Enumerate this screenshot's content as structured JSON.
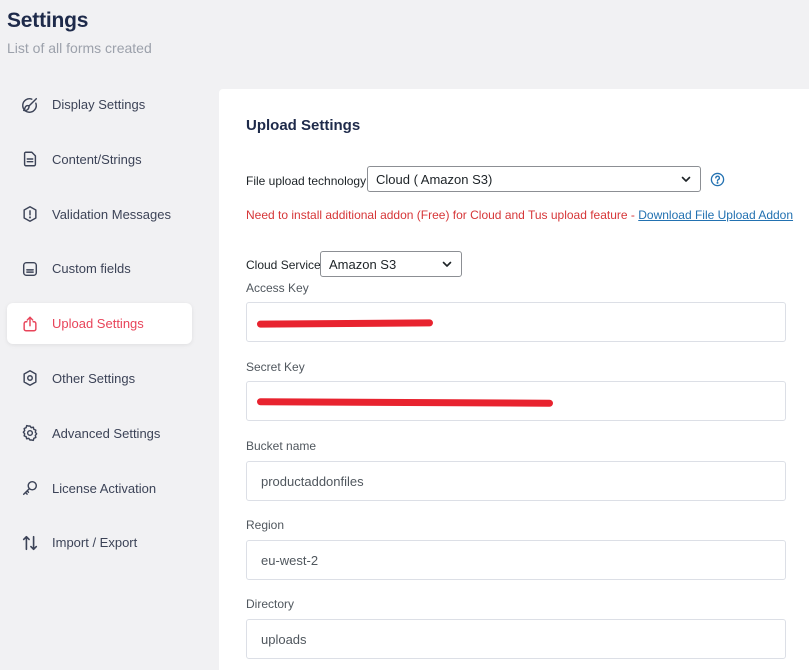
{
  "header": {
    "title": "Settings",
    "subtitle": "List of all forms created"
  },
  "sidebar": {
    "items": [
      {
        "label": "Display Settings",
        "icon": "brush-icon"
      },
      {
        "label": "Content/Strings",
        "icon": "document-icon"
      },
      {
        "label": "Validation Messages",
        "icon": "alert-icon"
      },
      {
        "label": "Custom fields",
        "icon": "card-icon"
      },
      {
        "label": "Upload Settings",
        "icon": "upload-icon",
        "active": true
      },
      {
        "label": "Other Settings",
        "icon": "hexagon-icon"
      },
      {
        "label": "Advanced Settings",
        "icon": "gear-icon"
      },
      {
        "label": "License Activation",
        "icon": "key-icon"
      },
      {
        "label": "Import / Export",
        "icon": "arrows-updown-icon"
      }
    ]
  },
  "panel": {
    "title": "Upload Settings",
    "upload_tech": {
      "label": "File upload technology",
      "value": "Cloud ( Amazon S3)"
    },
    "notice": {
      "text": "Need to install additional addon (Free) for Cloud and Tus upload feature - ",
      "link": "Download File Upload Addon"
    },
    "cloud_service": {
      "label": "Cloud Service",
      "value": "Amazon S3"
    },
    "access_key": {
      "label": "Access Key",
      "value": ""
    },
    "secret_key": {
      "label": "Secret Key",
      "value": ""
    },
    "bucket": {
      "label": "Bucket name",
      "value": "productaddonfiles"
    },
    "region": {
      "label": "Region",
      "value": "eu-west-2"
    },
    "directory": {
      "label": "Directory",
      "value": "uploads"
    }
  },
  "colors": {
    "accent": "#e8445a",
    "title": "#1e2a4a",
    "notice": "#d63638",
    "link": "#2271b1",
    "redaction": "#e8232f"
  }
}
